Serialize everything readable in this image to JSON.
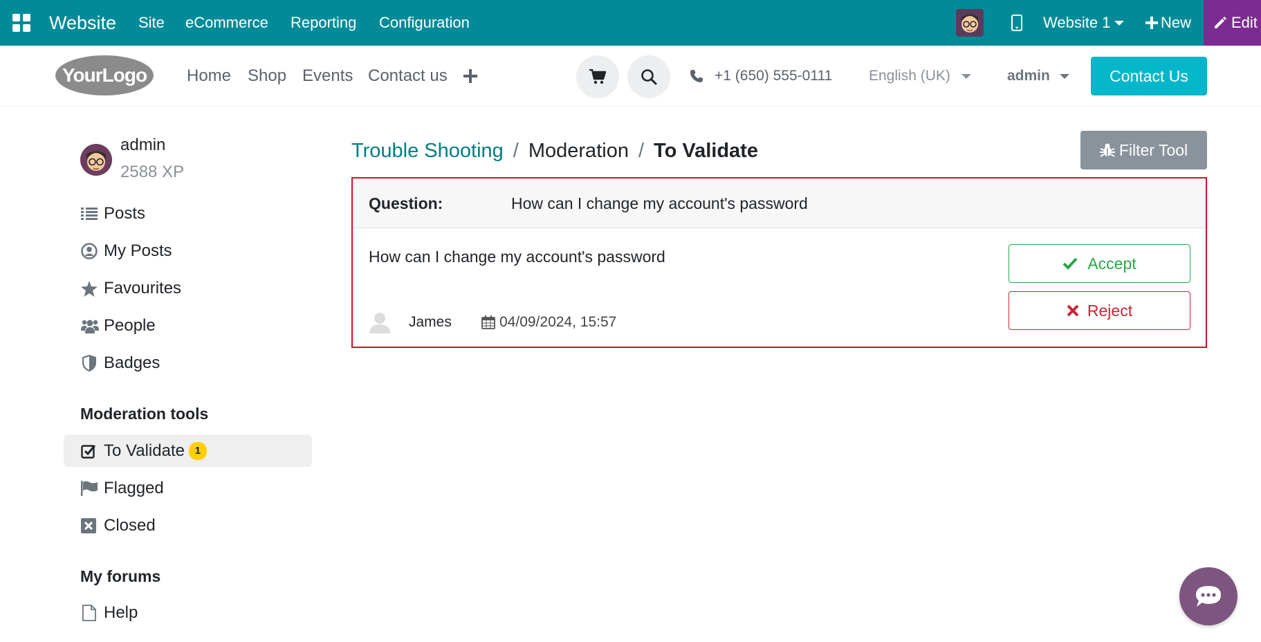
{
  "topbar": {
    "app_name": "Website",
    "menu": [
      "Site",
      "eCommerce",
      "Reporting",
      "Configuration"
    ],
    "website_switcher": "Website 1",
    "new_label": "New",
    "edit_label": "Edit",
    "bg_color": "#018b98",
    "edit_color": "#7c2c91"
  },
  "header": {
    "logo_text": "YourLogo",
    "nav": [
      "Home",
      "Shop",
      "Events",
      "Contact us"
    ],
    "phone": "+1 (650) 555-0111",
    "language": "English (UK)",
    "user": "admin",
    "contact_button": "Contact Us"
  },
  "sidebar": {
    "user_name": "admin",
    "xp": "2588 XP",
    "nav_items": [
      {
        "label": "Posts",
        "icon": "list-icon"
      },
      {
        "label": "My Posts",
        "icon": "user-circle-icon"
      },
      {
        "label": "Favourites",
        "icon": "star-icon"
      },
      {
        "label": "People",
        "icon": "users-icon"
      },
      {
        "label": "Badges",
        "icon": "shield-icon"
      }
    ],
    "moderation_heading": "Moderation tools",
    "moderation_items": [
      {
        "label": "To Validate",
        "icon": "check-square-icon",
        "count": "1",
        "active": true
      },
      {
        "label": "Flagged",
        "icon": "flag-icon"
      },
      {
        "label": "Closed",
        "icon": "close-square-icon"
      }
    ],
    "forums_heading": "My forums",
    "forums_items": [
      {
        "label": "Help",
        "icon": "file-icon"
      }
    ]
  },
  "main": {
    "breadcrumb": [
      "Trouble Shooting",
      "Moderation",
      "To Validate"
    ],
    "filter_tool": "Filter Tool",
    "card": {
      "question_label": "Question:",
      "question_title": "How can I change my account's password",
      "body": "How can I change my account's password",
      "author": "James",
      "date": "04/09/2024, 15:57",
      "accept_label": "Accept",
      "reject_label": "Reject"
    }
  }
}
